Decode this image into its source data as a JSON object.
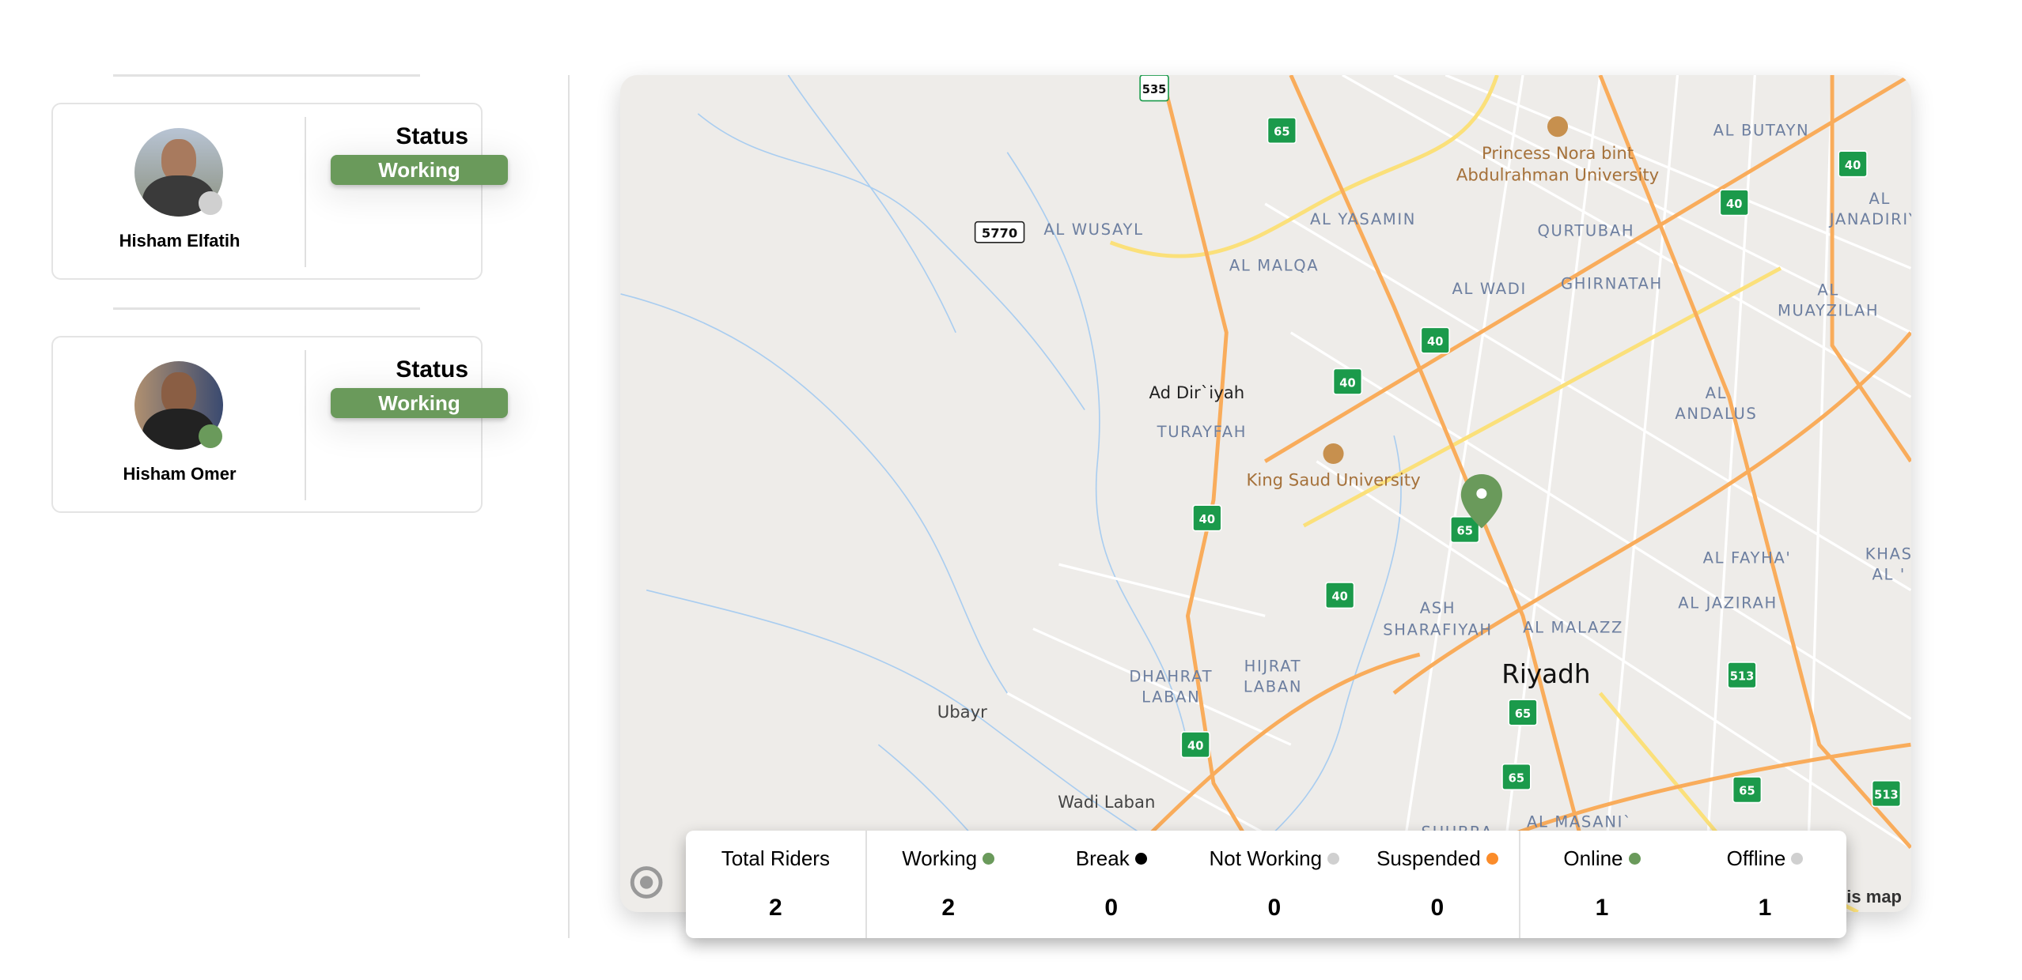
{
  "riders": [
    {
      "name": "Hisham Elfatih",
      "status_title": "Status",
      "status": "Working",
      "presence": "offline",
      "presence_color": "#d0d0d0"
    },
    {
      "name": "Hisham Omer",
      "status_title": "Status",
      "status": "Working",
      "presence": "online",
      "presence_color": "#6a9a5b"
    }
  ],
  "colors": {
    "working": "#6a9a5b",
    "break": "#000000",
    "not_working": "#d0d0d0",
    "suspended": "#fb8c2a",
    "online": "#6a9a5b",
    "offline": "#d0d0d0"
  },
  "map": {
    "attribution": "is map",
    "city": "Riyadh",
    "marker_color": "#6a9a5b",
    "labels": [
      "AL BUTAYN",
      "AL",
      "JANADIRIYA",
      "AL WUSAYL",
      "AL YASAMIN",
      "QURTUBAH",
      "AL MALQA",
      "AL WADI",
      "GHIRNATAH",
      "AL",
      "MUAYZILAH",
      "TURAYFAH",
      "AL",
      "ANDALUS",
      "AL FAYHA'",
      "KHAS",
      "AL '",
      "ASH",
      "SHARAFIYAH",
      "AL MALAZZ",
      "AL JAZIRAH",
      "HIJRAT",
      "LABAN",
      "DHAHRAT",
      "LABAN",
      "SHUBRA",
      "AL MASANI`"
    ],
    "places": [
      "Ad Dir`iyah",
      "Ubayr",
      "Wadi Laban"
    ],
    "pois": [
      "Princess Nora bint",
      "Abdulrahman University",
      "King Saud University"
    ],
    "shields": [
      "535",
      "65",
      "40",
      "40",
      "40",
      "40",
      "40",
      "65",
      "40",
      "513",
      "65",
      "40",
      "65",
      "65",
      "513"
    ],
    "road_numbers": [
      "5770"
    ]
  },
  "stats": {
    "total": {
      "label": "Total Riders",
      "value": "2"
    },
    "working": {
      "label": "Working",
      "value": "2"
    },
    "break": {
      "label": "Break",
      "value": "0"
    },
    "not_working": {
      "label": "Not Working",
      "value": "0"
    },
    "suspended": {
      "label": "Suspended",
      "value": "0"
    },
    "online": {
      "label": "Online",
      "value": "1"
    },
    "offline": {
      "label": "Offline",
      "value": "1"
    }
  }
}
